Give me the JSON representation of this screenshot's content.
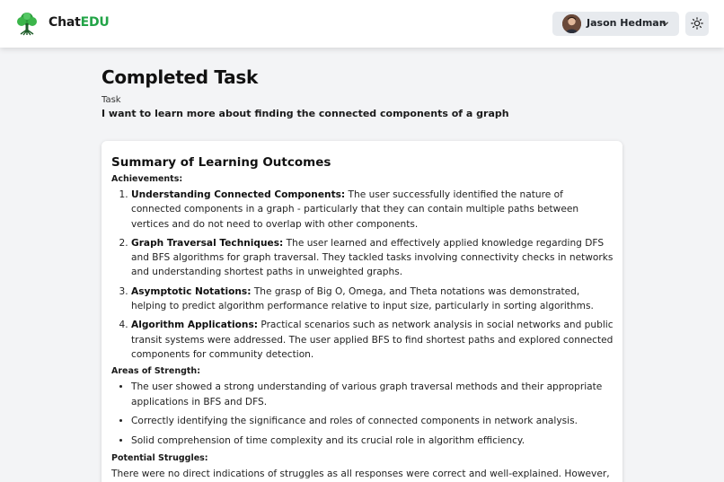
{
  "header": {
    "brand_part1": "Chat",
    "brand_part2": "EDU",
    "brand_accent_color": "#22a447",
    "user_name": "Jason Hedman",
    "logo_icon": "tree-icon",
    "theme_icon": "sun-icon",
    "dropdown_icon": "chevron-down-icon"
  },
  "page": {
    "title": "Completed Task",
    "task_label": "Task",
    "task_text": "I want to learn more about finding the connected components of a graph"
  },
  "summary": {
    "heading": "Summary of Learning Outcomes",
    "achievements_label": "Achievements:",
    "achievements": [
      {
        "title": "Understanding Connected Components:",
        "text": " The user successfully identified the nature of connected components in a graph - particularly that they can contain multiple paths between vertices and do not need to overlap with other components."
      },
      {
        "title": "Graph Traversal Techniques:",
        "text": " The user learned and effectively applied knowledge regarding DFS and BFS algorithms for graph traversal. They tackled tasks involving connectivity checks in networks and understanding shortest paths in unweighted graphs."
      },
      {
        "title": "Asymptotic Notations:",
        "text": " The grasp of Big O, Omega, and Theta notations was demonstrated, helping to predict algorithm performance relative to input size, particularly in sorting algorithms."
      },
      {
        "title": "Algorithm Applications:",
        "text": " Practical scenarios such as network analysis in social networks and public transit systems were addressed. The user applied BFS to find shortest paths and explored connected components for community detection."
      }
    ],
    "strengths_label": "Areas of Strength:",
    "strengths": [
      "The user showed a strong understanding of various graph traversal methods and their appropriate applications in BFS and DFS.",
      "Correctly identifying the significance and roles of connected components in network analysis.",
      "Solid comprehension of time complexity and its crucial role in algorithm efficiency."
    ],
    "struggles_label": "Potential Struggles:",
    "struggles_text": "There were no direct indications of struggles as all responses were correct and well-explained. However,"
  }
}
